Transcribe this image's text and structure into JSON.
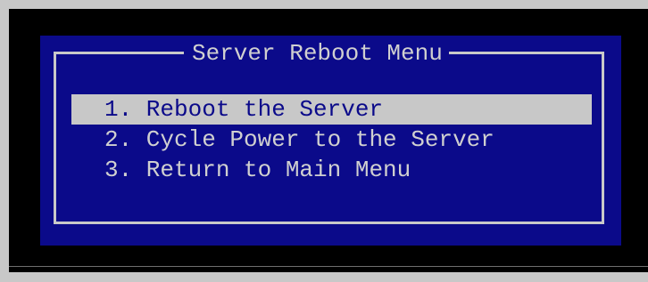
{
  "menu": {
    "title": "Server Reboot Menu",
    "items": [
      {
        "label": "1. Reboot the Server",
        "selected": true
      },
      {
        "label": "2. Cycle Power to the Server",
        "selected": false
      },
      {
        "label": "3. Return to Main Menu",
        "selected": false
      }
    ]
  },
  "colors": {
    "screen_background": "#000000",
    "panel_background": "#0b0a8a",
    "text": "#d0d0d0",
    "selection_background": "#c8c8c8"
  }
}
